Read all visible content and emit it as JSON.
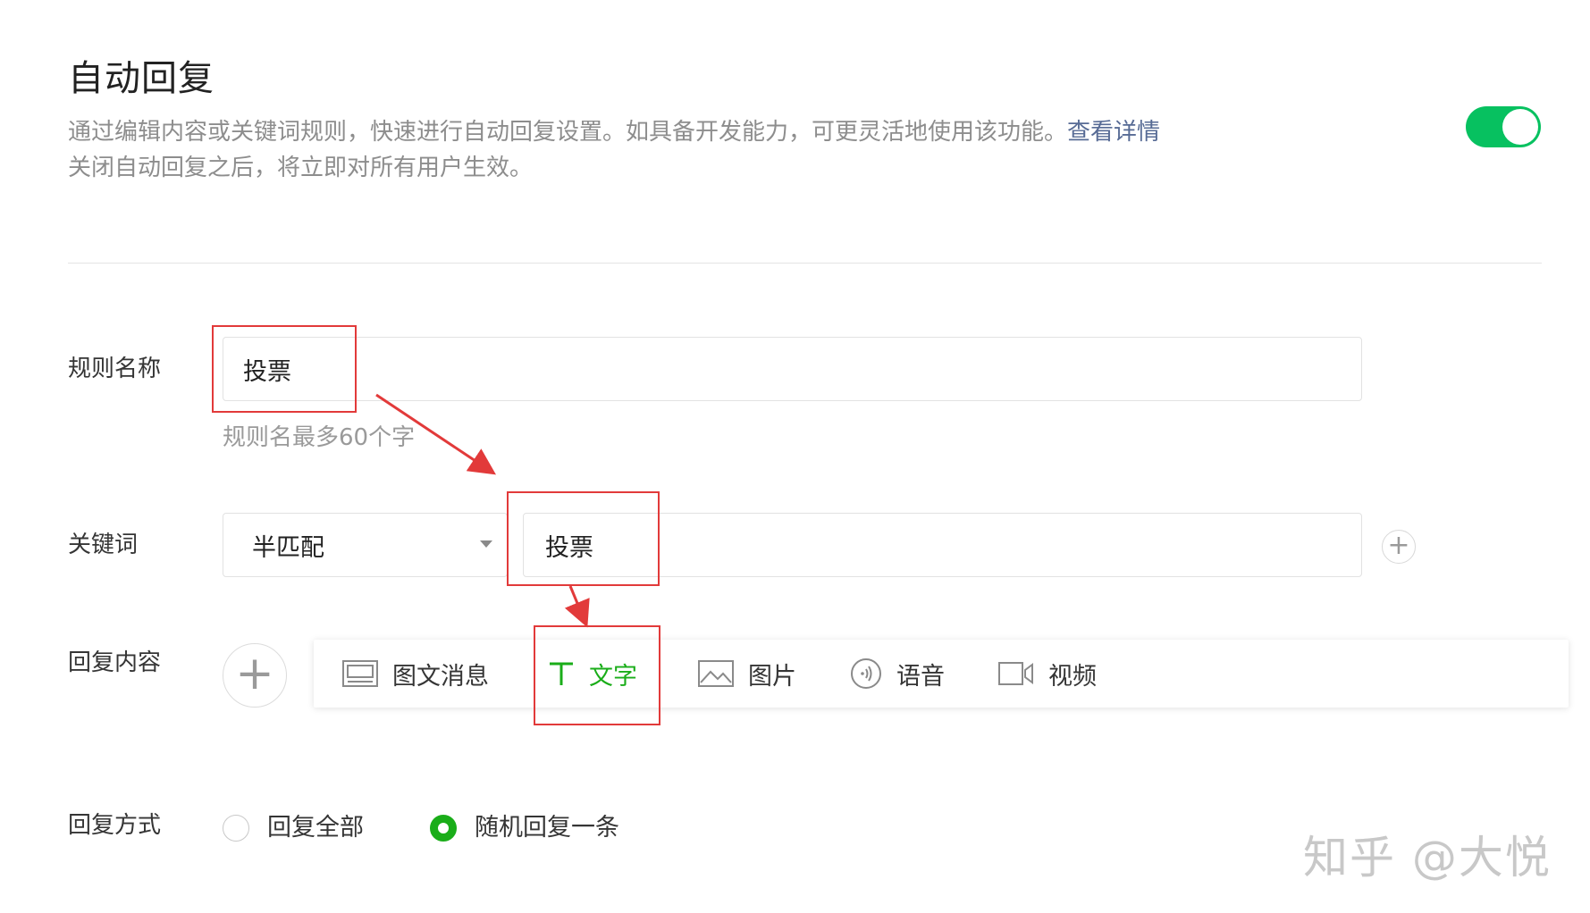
{
  "header": {
    "title": "自动回复",
    "desc_line1": "通过编辑内容或关键词规则，快速进行自动回复设置。如具备开发能力，可更灵活地使用该功能。",
    "detail_link": "查看详情",
    "desc_line2": "关闭自动回复之后，将立即对所有用户生效。",
    "toggle_on": true
  },
  "rule_name": {
    "label": "规则名称",
    "value": "投票",
    "hint": "规则名最多60个字"
  },
  "keyword": {
    "label": "关键词",
    "match_mode": "半匹配",
    "value": "投票",
    "add_icon": "plus-icon"
  },
  "reply_content": {
    "label": "回复内容",
    "add_icon": "plus-icon",
    "types": [
      {
        "label": "图文消息",
        "icon": "news-icon"
      },
      {
        "label": "文字",
        "icon": "text-icon",
        "active": true
      },
      {
        "label": "图片",
        "icon": "image-icon"
      },
      {
        "label": "语音",
        "icon": "voice-icon"
      },
      {
        "label": "视频",
        "icon": "video-icon"
      }
    ]
  },
  "reply_mode": {
    "label": "回复方式",
    "options": [
      {
        "label": "回复全部",
        "checked": false
      },
      {
        "label": "随机回复一条",
        "checked": true
      }
    ]
  },
  "colors": {
    "accent": "#1aad19",
    "toggle": "#07c160",
    "link": "#576b95",
    "annotation": "#e23a3a"
  },
  "watermark": "知乎 @大悦"
}
